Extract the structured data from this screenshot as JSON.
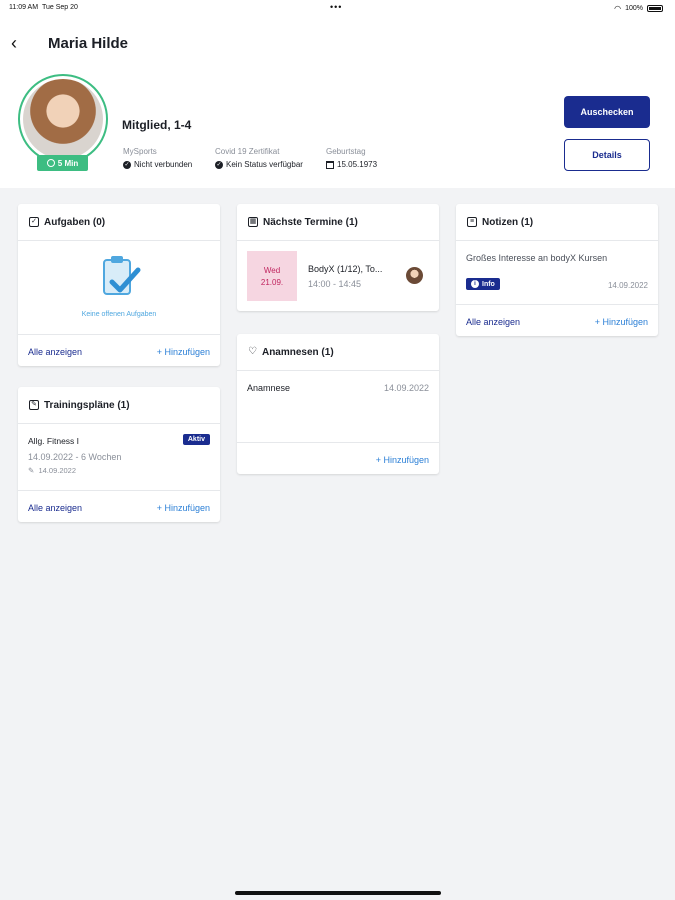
{
  "status_bar": {
    "time": "11:09 AM",
    "date": "Tue Sep 20",
    "dots": "•••",
    "battery": "100%"
  },
  "header": {
    "title": "Maria Hilde",
    "time_badge": "5 Min",
    "member": "Mitglied, 1-4",
    "meta": [
      {
        "label": "MySports",
        "value": "Nicht verbunden"
      },
      {
        "label": "Covid 19 Zertifikat",
        "value": "Kein Status verfügbar"
      },
      {
        "label": "Geburtstag",
        "value": "15.05.1973"
      }
    ],
    "checkout_label": "Auschecken",
    "details_label": "Details"
  },
  "aufgaben": {
    "title": "Aufgaben (0)",
    "empty_text": "Keine offenen Aufgaben",
    "show_all": "Alle anzeigen",
    "add": "+ Hinzufügen"
  },
  "trainingsplaene": {
    "title": "Trainingspläne (1)",
    "plan_name": "Allg. Fitness I",
    "status": "Aktiv",
    "dates": "14.09.2022 - 6 Wochen",
    "edited": "14.09.2022",
    "show_all": "Alle anzeigen",
    "add": "+ Hinzufügen"
  },
  "termine": {
    "title": "Nächste Termine (1)",
    "day": "Wed",
    "date": "21.09.",
    "event_title": "BodyX (1/12), To...",
    "event_time": "14:00 - 14:45"
  },
  "anamnesen": {
    "title": "Anamnesen (1)",
    "item_label": "Anamnese",
    "item_date": "14.09.2022",
    "add": "+ Hinzufügen"
  },
  "notizen": {
    "title": "Notizen (1)",
    "note_text": "Großes Interesse an bodyX Kursen",
    "tag": "Info",
    "note_date": "14.09.2022",
    "show_all": "Alle anzeigen",
    "add": "+ Hinzufügen"
  }
}
